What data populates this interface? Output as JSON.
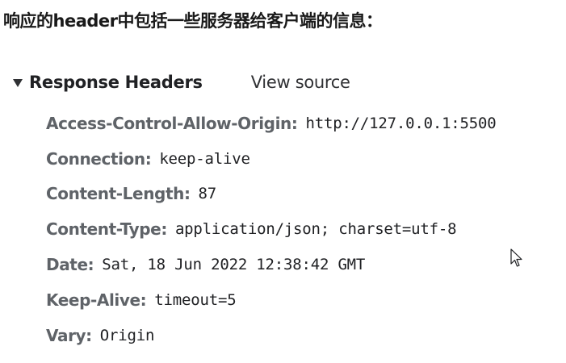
{
  "title": "响应的header中包括一些服务器给客户端的信息：",
  "section": {
    "title": "Response Headers",
    "view_source": "View source"
  },
  "headers": [
    {
      "name": "Access-Control-Allow-Origin:",
      "value": "http://127.0.0.1:5500"
    },
    {
      "name": "Connection:",
      "value": "keep-alive"
    },
    {
      "name": "Content-Length:",
      "value": "87"
    },
    {
      "name": "Content-Type:",
      "value": "application/json; charset=utf-8"
    },
    {
      "name": "Date:",
      "value": "Sat, 18 Jun 2022 12:38:42 GMT"
    },
    {
      "name": "Keep-Alive:",
      "value": "timeout=5"
    },
    {
      "name": "Vary:",
      "value": "Origin"
    }
  ],
  "icons": {
    "expand": "triangle-down-icon",
    "cursor": "mouse-pointer-icon"
  }
}
